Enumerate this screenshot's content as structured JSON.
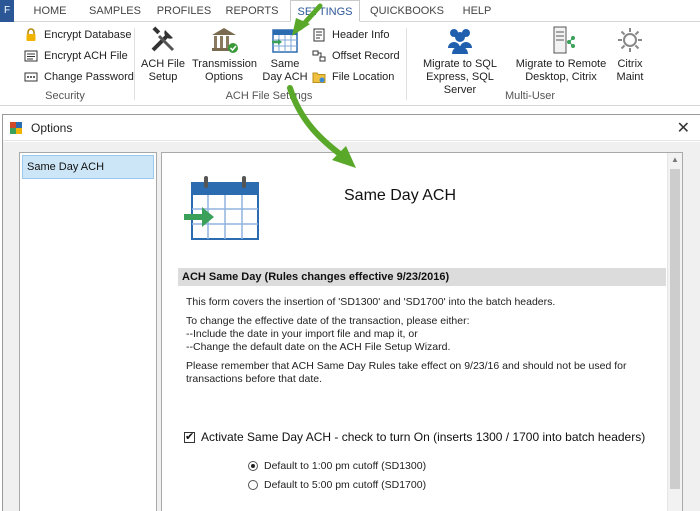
{
  "tabs": [
    {
      "label": "HOME"
    },
    {
      "label": "SAMPLES"
    },
    {
      "label": "PROFILES"
    },
    {
      "label": "REPORTS"
    },
    {
      "label": "SETTINGS"
    },
    {
      "label": "QUICKBOOKS"
    },
    {
      "label": "HELP"
    }
  ],
  "ribbon": {
    "security": {
      "items": [
        {
          "label": "Encrypt Database",
          "icon": "lock-icon"
        },
        {
          "label": "Encrypt ACH File",
          "icon": "encrypt-file-icon"
        },
        {
          "label": "Change Password",
          "icon": "password-icon"
        }
      ],
      "group_label": "Security"
    },
    "ach_file_settings": {
      "big_items": [
        {
          "label": "ACH File\nSetup",
          "icon": "tools-icon"
        },
        {
          "label": "Transmission\nOptions",
          "icon": "bank-icon"
        },
        {
          "label": "Same\nDay ACH",
          "icon": "calendar-icon"
        }
      ],
      "small_items": [
        {
          "label": "Header Info",
          "icon": "document-icon"
        },
        {
          "label": "Offset Record",
          "icon": "offset-icon"
        },
        {
          "label": "File Location",
          "icon": "folder-icon"
        }
      ],
      "group_label": "ACH File Settings"
    },
    "multi_user": {
      "big_items": [
        {
          "label": "Migrate to SQL\nExpress, SQL Server",
          "icon": "users-icon"
        },
        {
          "label": "Migrate to Remote\nDesktop, Citrix",
          "icon": "server-icon"
        },
        {
          "label": "Citrix\nMaint",
          "icon": "gear-icon"
        }
      ],
      "group_label": "Multi-User"
    }
  },
  "window": {
    "title": "Options",
    "close_glyph": "✕",
    "list_items": [
      "Same Day ACH"
    ],
    "panel_title": "Same Day ACH",
    "section_header": "ACH Same Day (Rules changes effective 9/23/2016)",
    "para1": "This form covers the insertion of 'SD1300' and 'SD1700' into the batch headers.",
    "para2_lines": [
      "To change the effective date of the transaction, please either:",
      "--Include the date in your import file and map it, or",
      "--Change the default date on the ACH File Setup Wizard."
    ],
    "para3_lines": [
      "Please remember that ACH Same Day Rules take effect on 9/23/16 and should not be used for",
      "transactions before that date."
    ],
    "checkbox_label": "Activate Same Day ACH - check to turn On (inserts 1300 / 1700 into batch headers)",
    "checkbox_checked": true,
    "radio_options": [
      {
        "label": "Default to 1:00 pm cutoff (SD1300)",
        "selected": true
      },
      {
        "label": "Default to 5:00 pm cutoff (SD1700)",
        "selected": false
      }
    ]
  },
  "colors": {
    "accent_blue": "#2b5797",
    "annotation_green": "#5aa82a",
    "selection_bg": "#cde6f7"
  }
}
